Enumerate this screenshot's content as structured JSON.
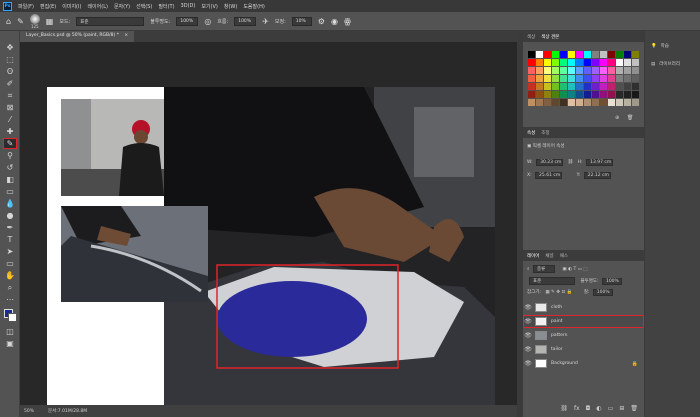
{
  "app": {
    "logo": "Ps"
  },
  "menu": [
    "파일(F)",
    "편집(E)",
    "이미지(I)",
    "레이어(L)",
    "문자(Y)",
    "선택(S)",
    "필터(T)",
    "3D(D)",
    "보기(V)",
    "창(W)",
    "도움말(H)"
  ],
  "options": {
    "brush_size": "125",
    "mode_label": "모드:",
    "mode_value": "표준",
    "opacity_label": "불투명도:",
    "opacity_value": "100%",
    "flow_label": "흐름:",
    "flow_value": "100%",
    "smooth_label": "보정:",
    "smooth_value": "10%"
  },
  "document": {
    "tab_title": "Layer_Basics.psd @ 50% (paint, RGB/8) *"
  },
  "status": {
    "zoom": "50%",
    "doc_info": "문서:7.01M/28.8M"
  },
  "swatches_panel": {
    "tabs": [
      "색상",
      "색상 견본"
    ],
    "colors": [
      "#000000",
      "#ffffff",
      "#ff0000",
      "#00ff00",
      "#0000ff",
      "#ffff00",
      "#ff00ff",
      "#00ffff",
      "#808080",
      "#c0c0c0",
      "#800000",
      "#008000",
      "#000080",
      "#808000",
      "#ff0000",
      "#ff8000",
      "#ffff00",
      "#80ff00",
      "#00ff80",
      "#00ffff",
      "#0080ff",
      "#0000ff",
      "#8000ff",
      "#ff00ff",
      "#ff0080",
      "#ffffff",
      "#e0e0e0",
      "#c0c0c0",
      "#ff6060",
      "#ffa060",
      "#ffff80",
      "#a0ff60",
      "#60ffa0",
      "#60ffff",
      "#60a0ff",
      "#6060ff",
      "#a060ff",
      "#ff60ff",
      "#ff60a0",
      "#b0b0b0",
      "#a0a0a0",
      "#909090",
      "#f06040",
      "#f0a040",
      "#f0e040",
      "#90e040",
      "#40e090",
      "#40e0e0",
      "#4090f0",
      "#4050f0",
      "#9040f0",
      "#e040e0",
      "#e04090",
      "#808080",
      "#707070",
      "#606060",
      "#c83020",
      "#c87820",
      "#c8c020",
      "#70c020",
      "#20c070",
      "#20c0c0",
      "#2070c8",
      "#2030c8",
      "#7020c8",
      "#c020c0",
      "#c02070",
      "#505050",
      "#404040",
      "#303030",
      "#902010",
      "#905010",
      "#908010",
      "#508010",
      "#109050",
      "#108080",
      "#105090",
      "#102090",
      "#501090",
      "#901080",
      "#901050",
      "#282828",
      "#202020",
      "#181818",
      "#c09060",
      "#a07850",
      "#806040",
      "#604830",
      "#403020",
      "#e0c0a0",
      "#d0b090",
      "#b09070",
      "#907050",
      "#705030",
      "#e8e0d0",
      "#d0c8b8",
      "#b8b0a0",
      "#a09888"
    ]
  },
  "properties_panel": {
    "tabs": [
      "속성",
      "조정"
    ],
    "heading": "픽셀 레이어 속성",
    "w_label": "W:",
    "w_value": "30.23 cm",
    "h_label": "H:",
    "h_value": "13.97 cm",
    "x_label": "X:",
    "x_value": "25.61 cm",
    "y_label": "Y:",
    "y_value": "22.12 cm",
    "link_icon": "link-icon"
  },
  "layers_panel": {
    "tabs": [
      "레이어",
      "채널",
      "패스"
    ],
    "filter_label": "종류",
    "blend_mode": "표준",
    "opacity_label": "불투명도:",
    "opacity_value": "100%",
    "lock_label": "잠그기:",
    "fill_label": "칠:",
    "fill_value": "100%",
    "layers": [
      {
        "name": "cloth",
        "selected": false,
        "locked": false
      },
      {
        "name": "paint",
        "selected": true,
        "locked": false
      },
      {
        "name": "pattern",
        "selected": false,
        "locked": false
      },
      {
        "name": "tailor",
        "selected": false,
        "locked": false
      },
      {
        "name": "Background",
        "selected": false,
        "locked": true
      }
    ]
  },
  "learn_panel": {
    "items": [
      "학습",
      "라이브러리"
    ]
  },
  "annotation_color": "#e0252a",
  "paint_color": "#2a2a9a"
}
